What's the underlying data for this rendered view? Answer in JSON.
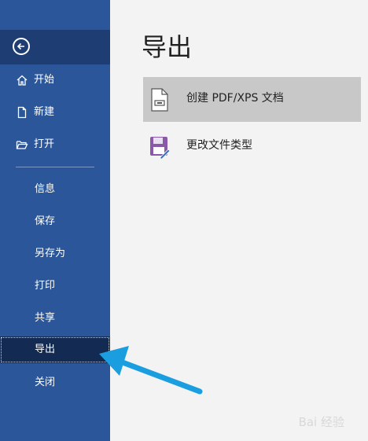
{
  "sidebar": {
    "top_items": [
      {
        "label": "开始",
        "icon": "home-icon"
      },
      {
        "label": "新建",
        "icon": "new-document-icon"
      },
      {
        "label": "打开",
        "icon": "open-folder-icon"
      }
    ],
    "items": [
      {
        "label": "信息"
      },
      {
        "label": "保存"
      },
      {
        "label": "另存为"
      },
      {
        "label": "打印"
      },
      {
        "label": "共享"
      },
      {
        "label": "导出"
      },
      {
        "label": "关闭"
      }
    ],
    "active_item": "导出"
  },
  "main": {
    "title": "导出",
    "options": [
      {
        "label": "创建 PDF/XPS 文档",
        "icon": "pdf-document-icon",
        "selected": true
      },
      {
        "label": "更改文件类型",
        "icon": "change-filetype-icon",
        "selected": false
      }
    ]
  },
  "colors": {
    "sidebar_bg": "#2b579a",
    "sidebar_active": "#132b52",
    "annotation_arrow": "#1a9ee0"
  },
  "watermark": "Bai 经验"
}
